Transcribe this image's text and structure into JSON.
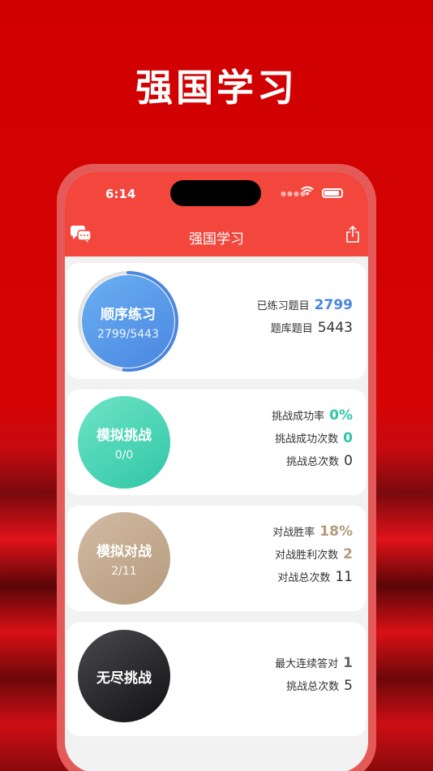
{
  "promo": {
    "title": "强国学习"
  },
  "status_bar": {
    "time": "6:14"
  },
  "app_bar": {
    "title": "强国学习"
  },
  "colors": {
    "accent_blue": "#4a86e0",
    "accent_teal": "#2fc7a7",
    "accent_tan": "#b59a7c",
    "dark": "#2c2c2e"
  },
  "cards": [
    {
      "circle_title": "顺序练习",
      "circle_sub": "2799/5443",
      "progress": 0.514,
      "stats": [
        {
          "label": "已练习题目",
          "value": "2799"
        },
        {
          "label": "题库题目",
          "value": "5443"
        }
      ]
    },
    {
      "circle_title": "模拟挑战",
      "circle_sub": "0/0",
      "stats": [
        {
          "label": "挑战成功率",
          "value": "0%"
        },
        {
          "label": "挑战成功次数",
          "value": "0"
        },
        {
          "label": "挑战总次数",
          "value": "0"
        }
      ]
    },
    {
      "circle_title": "模拟对战",
      "circle_sub": "2/11",
      "stats": [
        {
          "label": "对战胜率",
          "value": "18%"
        },
        {
          "label": "对战胜利次数",
          "value": "2"
        },
        {
          "label": "对战总次数",
          "value": "11"
        }
      ]
    },
    {
      "circle_title": "无尽挑战",
      "stats": [
        {
          "label": "最大连续答对",
          "value": "1"
        },
        {
          "label": "挑战总次数",
          "value": "5"
        }
      ]
    }
  ],
  "icons": {
    "chat": "chat-bubbles-icon",
    "share": "share-icon",
    "wifi": "wifi-icon",
    "battery": "battery-icon"
  }
}
